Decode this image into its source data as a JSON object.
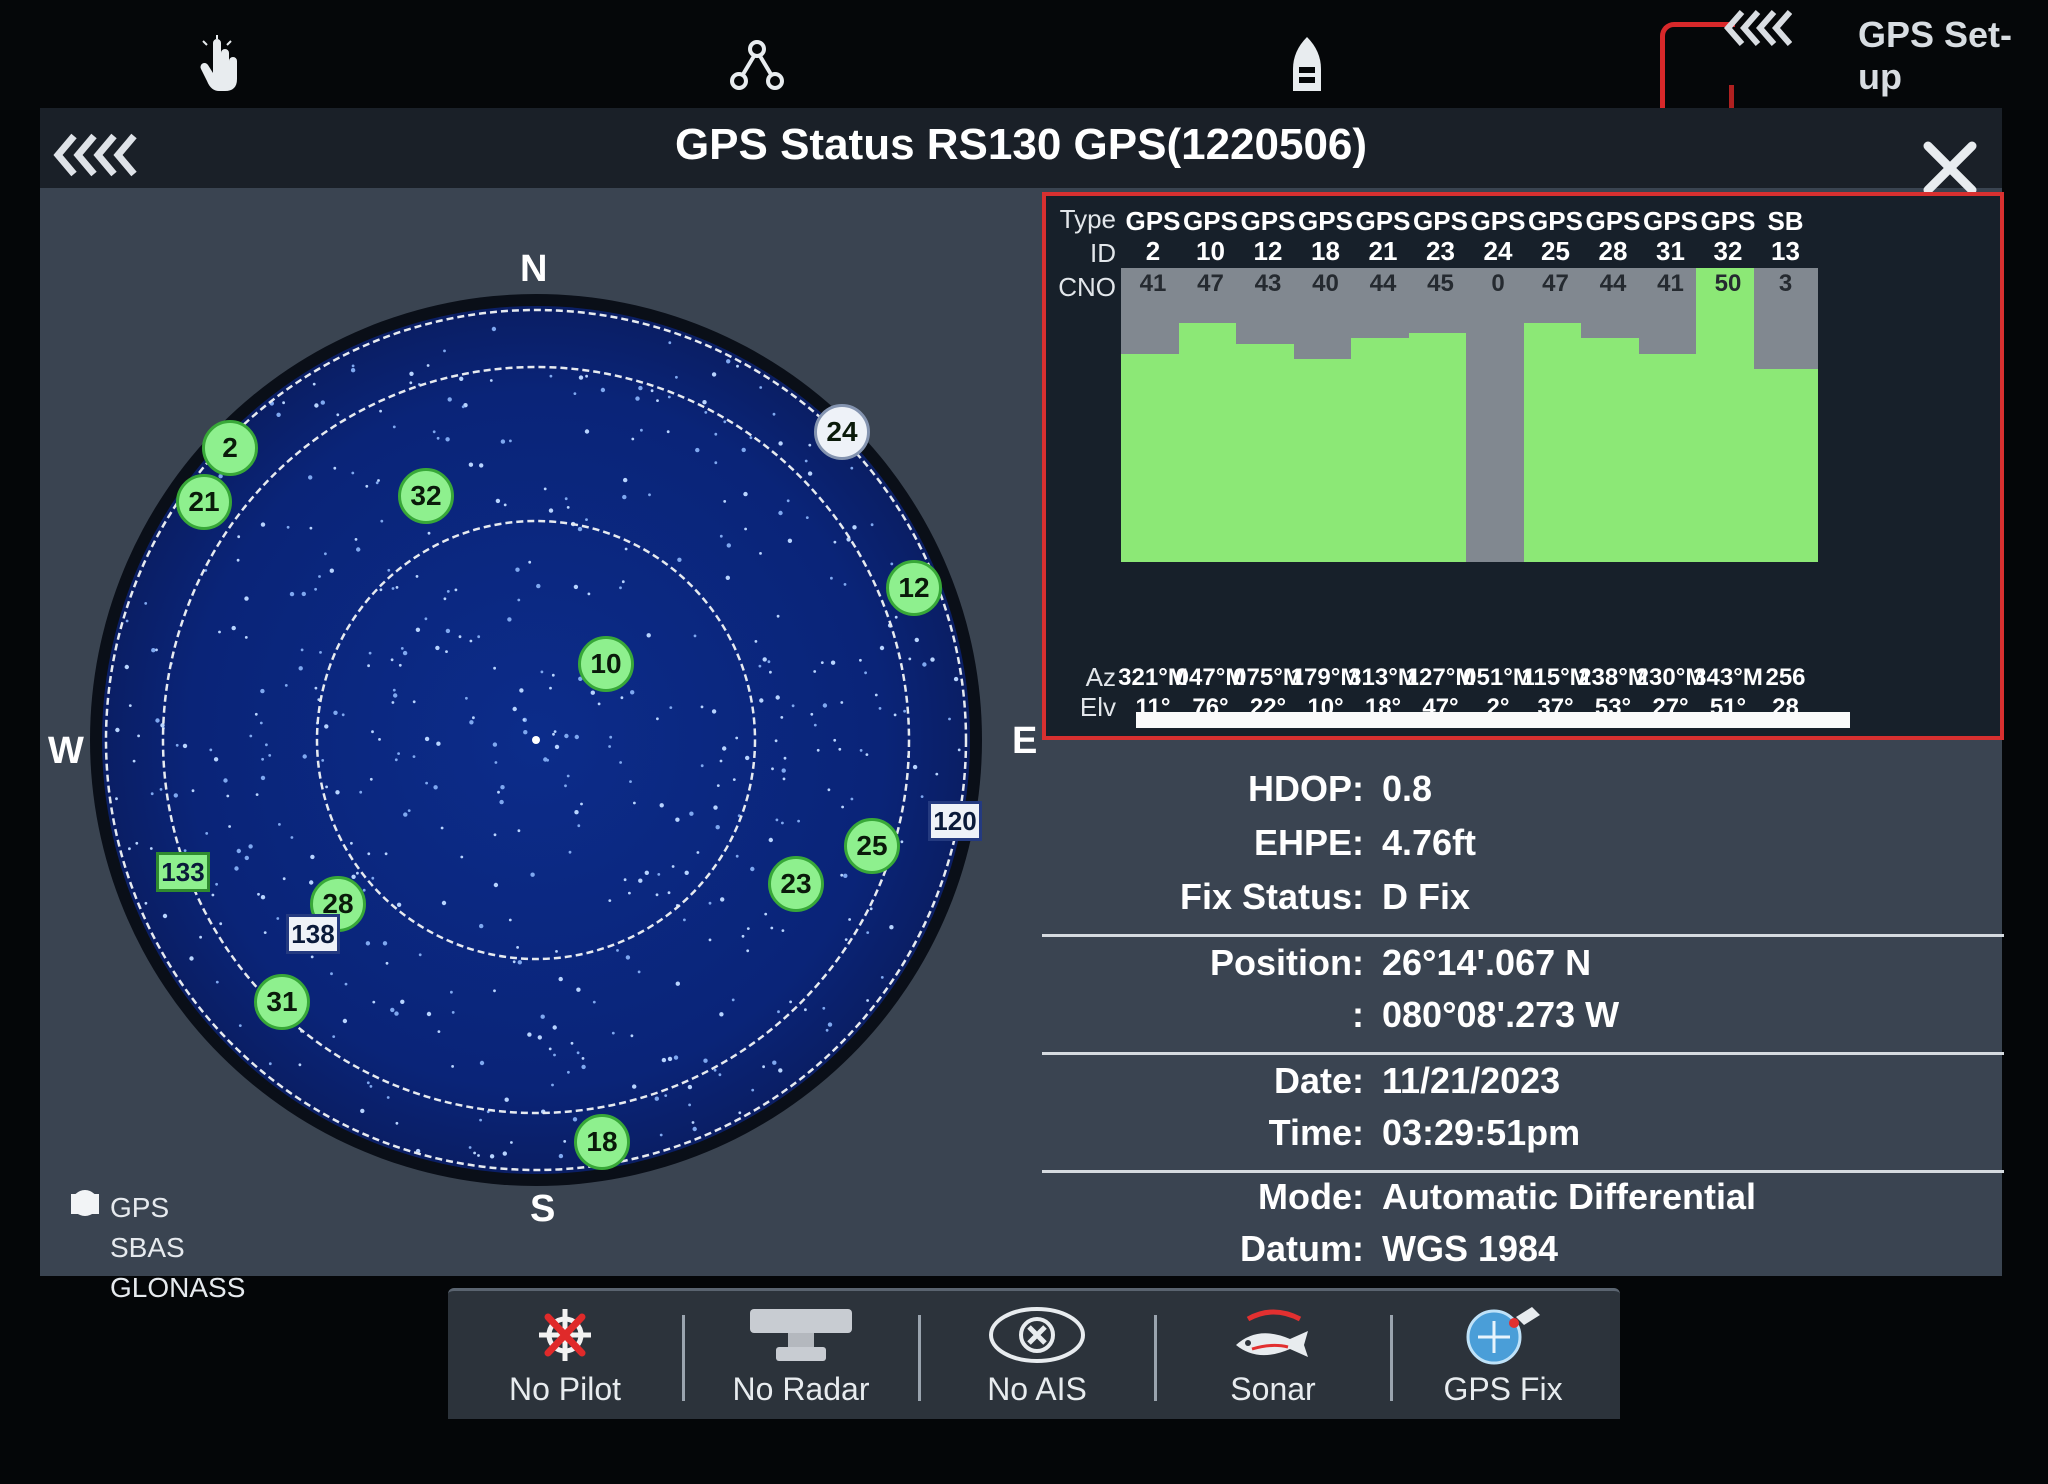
{
  "top_nav": {
    "icons": [
      "touch-icon",
      "waypoint-route-icon",
      "boat-icon"
    ],
    "setup_label": "GPS Set-up"
  },
  "panel": {
    "title": "GPS Status RS130 GPS(1220506)",
    "back_icon": "triple-chevron-left-icon",
    "close_icon": "close-icon"
  },
  "skyplot": {
    "compass": {
      "n": "N",
      "s": "S",
      "e": "E",
      "w": "W"
    },
    "gps_sats": [
      {
        "id": "2",
        "color": "green"
      },
      {
        "id": "21",
        "color": "green"
      },
      {
        "id": "32",
        "color": "green"
      },
      {
        "id": "24",
        "color": "white"
      },
      {
        "id": "12",
        "color": "green"
      },
      {
        "id": "10",
        "color": "green"
      },
      {
        "id": "25",
        "color": "green"
      },
      {
        "id": "23",
        "color": "green"
      },
      {
        "id": "28",
        "color": "green"
      },
      {
        "id": "31",
        "color": "green"
      },
      {
        "id": "18",
        "color": "green"
      }
    ],
    "sbas_sats": [
      {
        "id": "120",
        "color": "white"
      },
      {
        "id": "133",
        "color": "green"
      },
      {
        "id": "138",
        "color": "white"
      }
    ],
    "legend": {
      "gps": "GPS",
      "sbas": "SBAS",
      "glonass": "GLONASS"
    }
  },
  "signal_table": {
    "row_labels": {
      "type": "Type",
      "id": "ID",
      "cno": "CNO",
      "az": "Az",
      "elv": "Elv"
    },
    "columns": [
      {
        "type": "GPS",
        "id": "2",
        "cno": 41,
        "cno_label": "41",
        "az": "321°M",
        "elv": "11°",
        "fill": "green"
      },
      {
        "type": "GPS",
        "id": "10",
        "cno": 47,
        "cno_label": "47",
        "az": "047°M",
        "elv": "76°",
        "fill": "green"
      },
      {
        "type": "GPS",
        "id": "12",
        "cno": 43,
        "cno_label": "43",
        "az": "075°M",
        "elv": "22°",
        "fill": "green"
      },
      {
        "type": "GPS",
        "id": "18",
        "cno": 40,
        "cno_label": "40",
        "az": "179°M",
        "elv": "10°",
        "fill": "green"
      },
      {
        "type": "GPS",
        "id": "21",
        "cno": 44,
        "cno_label": "44",
        "az": "313°M",
        "elv": "18°",
        "fill": "green"
      },
      {
        "type": "GPS",
        "id": "23",
        "cno": 45,
        "cno_label": "45",
        "az": "127°M",
        "elv": "47°",
        "fill": "green"
      },
      {
        "type": "GPS",
        "id": "24",
        "cno": 0,
        "cno_label": "0",
        "az": "051°M",
        "elv": "2°",
        "fill": "grey"
      },
      {
        "type": "GPS",
        "id": "25",
        "cno": 47,
        "cno_label": "47",
        "az": "115°M",
        "elv": "37°",
        "fill": "green"
      },
      {
        "type": "GPS",
        "id": "28",
        "cno": 44,
        "cno_label": "44",
        "az": "238°M",
        "elv": "53°",
        "fill": "green"
      },
      {
        "type": "GPS",
        "id": "31",
        "cno": 41,
        "cno_label": "41",
        "az": "230°M",
        "elv": "27°",
        "fill": "green"
      },
      {
        "type": "GPS",
        "id": "32",
        "cno": 50,
        "cno_label": "50",
        "az": "343°M",
        "elv": "51°",
        "fill": "green"
      },
      {
        "type": "SB",
        "id": "13",
        "cno": 38,
        "cno_label": "3",
        "az": "256",
        "elv": "28",
        "fill": "green"
      }
    ],
    "cno_max": 50,
    "accent": "#d83030",
    "bar_green": "#8ce876"
  },
  "info": {
    "hdop": {
      "label": "HDOP:",
      "value": "0.8"
    },
    "ehpe": {
      "label": "EHPE:",
      "value": "4.76ft"
    },
    "fix": {
      "label": "Fix Status:",
      "value": "D Fix"
    },
    "position": {
      "label": "Position:",
      "lat": "26°14'.067 N",
      "sep": ":",
      "lon": "080°08'.273 W"
    },
    "date": {
      "label": "Date:",
      "value": "11/21/2023"
    },
    "time": {
      "label": "Time:",
      "value": "03:29:51pm"
    },
    "mode": {
      "label": "Mode:",
      "value": "Automatic Differential"
    },
    "datum": {
      "label": "Datum:",
      "value": "WGS 1984"
    }
  },
  "bottom_bar": [
    {
      "label": "No Pilot",
      "icon": "autopilot-off-icon"
    },
    {
      "label": "No Radar",
      "icon": "radar-icon"
    },
    {
      "label": "No AIS",
      "icon": "ais-off-icon"
    },
    {
      "label": "Sonar",
      "icon": "sonar-fish-icon"
    },
    {
      "label": "GPS Fix",
      "icon": "gps-fix-icon"
    }
  ]
}
